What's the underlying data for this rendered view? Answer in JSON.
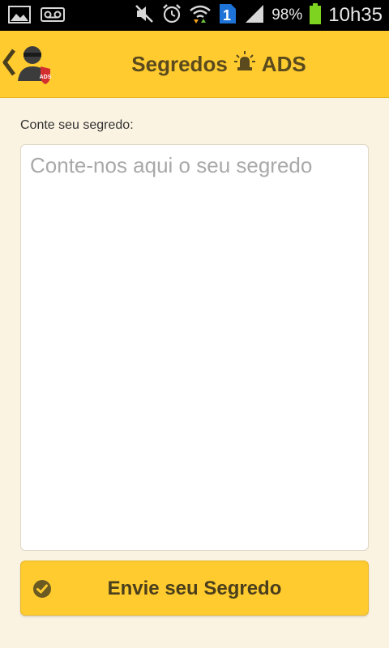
{
  "status_bar": {
    "battery_percent": "98%",
    "clock": "10h35",
    "sim_badge": "1",
    "battery_level": 0.98,
    "icons": [
      "image-icon",
      "voicemail-icon",
      "mute-icon",
      "alarm-icon",
      "wifi-icon",
      "sim-icon",
      "signal-icon",
      "battery-icon"
    ]
  },
  "header": {
    "title_left": "Segredos",
    "title_right": "ADS",
    "logo_badge": "ADS",
    "accent_color": "#FFCB2F",
    "title_color": "#5A4A1E"
  },
  "form": {
    "label": "Conte seu segredo:",
    "placeholder": "Conte-nos aqui o seu segredo",
    "value": ""
  },
  "submit": {
    "label": "Envie seu Segredo"
  }
}
